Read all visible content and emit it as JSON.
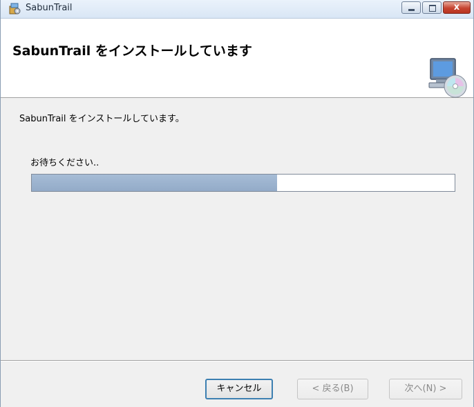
{
  "window": {
    "title": "SabunTrail",
    "caption_buttons": {
      "minimize": "minimize",
      "maximize": "maximize",
      "close": "x"
    }
  },
  "header": {
    "title": "SabunTrail をインストールしています",
    "icon": "computer-cd-icon"
  },
  "body": {
    "status": "SabunTrail をインストールしています。",
    "wait_label": "お待ちください..",
    "progress_fraction": 0.58
  },
  "footer": {
    "cancel_label": "キャンセル",
    "back_label": "< 戻る(B)",
    "next_label": "次へ(N) >"
  },
  "colors": {
    "progress_fill": "#99b0cc",
    "banner_bg": "#ffffff",
    "body_bg": "#f0f0f0",
    "close_button": "#c64430"
  }
}
